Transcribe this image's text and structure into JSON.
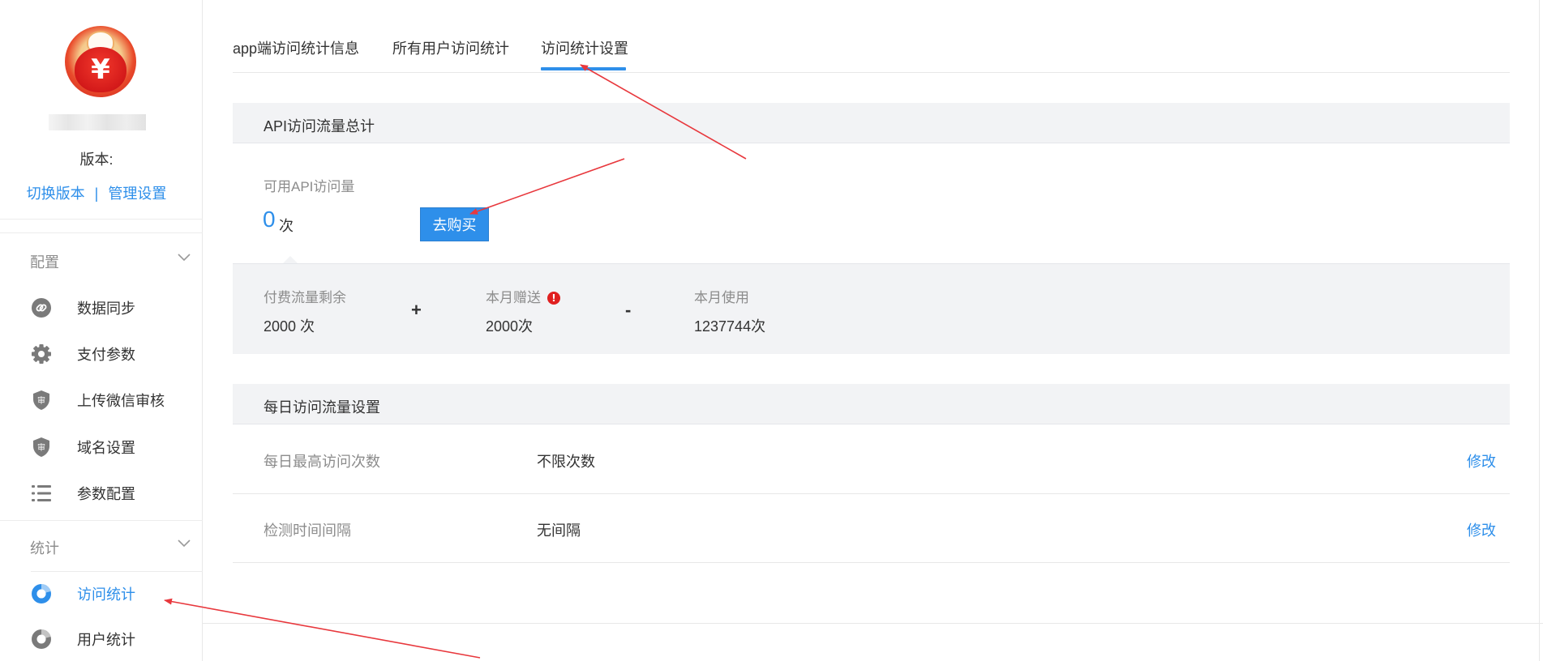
{
  "sidebar": {
    "version_label": "版本:",
    "switch_version": "切换版本",
    "link_separator": "|",
    "manage_settings": "管理设置",
    "groups": [
      {
        "title": "配置",
        "items": [
          {
            "label": "数据同步",
            "icon": "link-icon"
          },
          {
            "label": "支付参数",
            "icon": "gear-icon"
          },
          {
            "label": "上传微信审核",
            "icon": "shield-icon"
          },
          {
            "label": "域名设置",
            "icon": "shield-icon"
          },
          {
            "label": "参数配置",
            "icon": "list-icon"
          }
        ]
      },
      {
        "title": "统计",
        "items": [
          {
            "label": "访问统计",
            "icon": "stats-ring-icon",
            "active": true
          },
          {
            "label": "用户统计",
            "icon": "stats-ring-icon"
          }
        ]
      }
    ]
  },
  "tabs": [
    {
      "label": "app端访问统计信息"
    },
    {
      "label": "所有用户访问统计"
    },
    {
      "label": "访问统计设置",
      "active": true
    }
  ],
  "api_total": {
    "title": "API访问流量总计",
    "available_label": "可用API访问量",
    "available_value": "0",
    "available_unit": "次",
    "buy_button": "去购买",
    "paid_remaining_label": "付费流量剩余",
    "paid_remaining_value": "2000 次",
    "plus": "+",
    "monthly_gift_label": "本月赠送",
    "info_mark": "!",
    "monthly_gift_value": "2000次",
    "minus": "-",
    "monthly_used_label": "本月使用",
    "monthly_used_value": "1237744次"
  },
  "daily_settings": {
    "title": "每日访问流量设置",
    "rows": [
      {
        "label": "每日最高访问次数",
        "value": "不限次数",
        "action": "修改"
      },
      {
        "label": "检测时间间隔",
        "value": "无间隔",
        "action": "修改"
      }
    ]
  },
  "colors": {
    "accent": "#2e8fea",
    "section_bg": "#f2f3f5",
    "annotation_arrow": "#e8383d",
    "info_red": "#e02020"
  }
}
